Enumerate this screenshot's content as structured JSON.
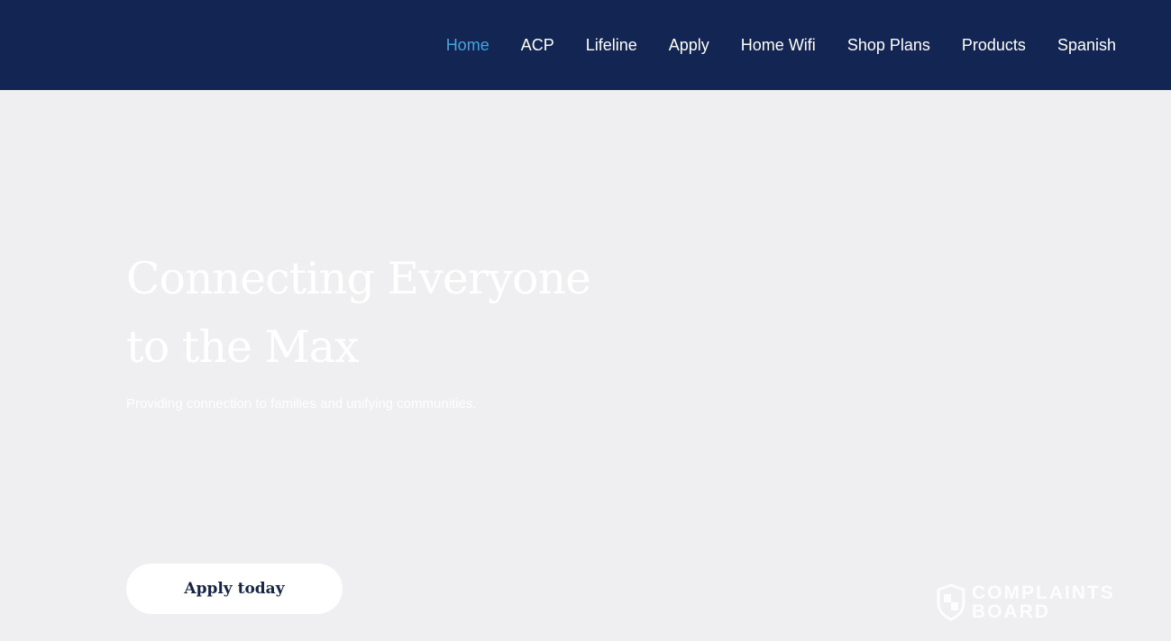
{
  "nav": {
    "items": [
      {
        "label": "Home",
        "active": true
      },
      {
        "label": "ACP"
      },
      {
        "label": "Lifeline"
      },
      {
        "label": "Apply"
      },
      {
        "label": "Home Wifi"
      },
      {
        "label": "Shop Plans"
      },
      {
        "label": "Products"
      },
      {
        "label": "Spanish"
      }
    ]
  },
  "hero": {
    "title_line1": "Connecting Everyone",
    "title_line2": "to the Max",
    "subtitle": "Providing connection to families and unifying communities.",
    "cta_label": "Apply today"
  },
  "watermark": {
    "line1": "COMPLAINTS",
    "line2": "BOARD"
  },
  "colors": {
    "header_bg": "#132653",
    "nav_active": "#42a5e0",
    "hero_bg": "#efeef0",
    "button_text": "#152447"
  }
}
